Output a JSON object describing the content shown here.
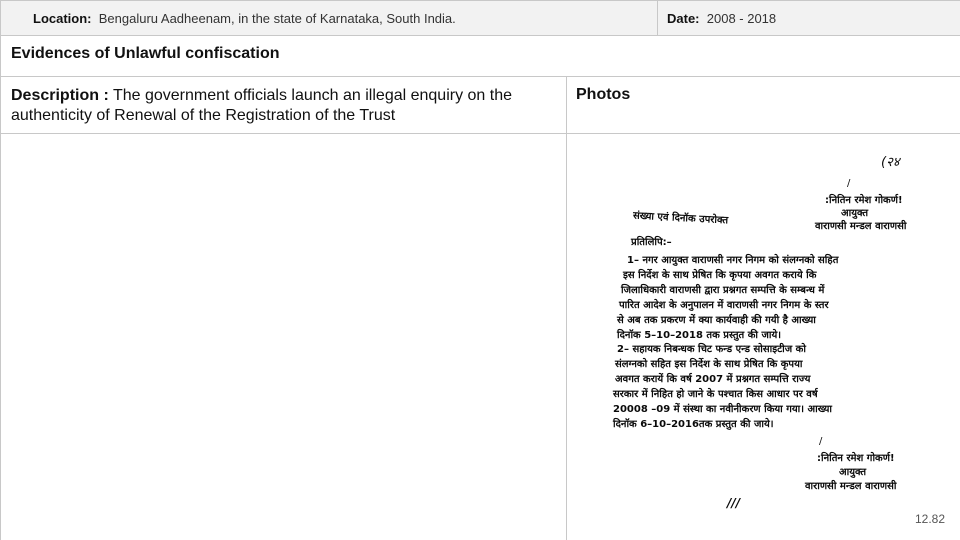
{
  "header": {
    "location_label": "Location:",
    "location_value": "Bengaluru Aadheenam, in the state of Karnataka, South India.",
    "date_label": "Date:",
    "date_value": "2008 - 2018"
  },
  "section": {
    "title": "Evidences of Unlawful confiscation"
  },
  "description": {
    "label": "Description :",
    "text": " The government officials launch an illegal enquiry on the authenticity of Renewal of the Registration of the Trust",
    "photos_label": "Photos"
  },
  "document_scan": {
    "page_mark": "(२४",
    "sig_top_1": "/",
    "sig_top_2": ":नितिन रमेश गोकर्ण!",
    "sig_top_3": "आयुक्त",
    "sig_top_4": "वाराणसी मन्डल वाराणसी",
    "ref_line": "संख्या एवं दिनॉक उपरोक्त",
    "copy_label": "प्रतिलिपि:–",
    "p1_l1": "1– नगर आयुक्त वाराणसी नगर निगम को संलग्नको सहित",
    "p1_l2": "इस निर्देश के साथ प्रेषित कि कृपया अवगत कराये कि",
    "p1_l3": "जिलाधिकारी वाराणसी द्वारा प्रश्नगत सम्पत्ति के सम्बन्ध में",
    "p1_l4": "पारित आदेश के अनुपालन में वाराणसी नगर निगम के स्तर",
    "p1_l5": "से अब तक प्रकरण में क्या कार्यवाही की गयी है आख्या",
    "p1_l6": "दिनॉक 5–10–2018 तक प्रस्तुत की जाये।",
    "p2_l1": "2– सहायक निबन्धक चिट फन्ड एन्ड सोसाइटीज को",
    "p2_l2": "संलग्नको सहित इस निर्देश के साथ प्रेषित कि कृपया",
    "p2_l3": "अवगत करायें कि वर्ष 2007 में प्रश्नगत सम्पत्ति राज्य",
    "p2_l4": "सरकार में निहित हो जाने के पश्चात किस आधार पर वर्ष",
    "p2_l5": "20008 –09 में संस्था का नवीनीकरण किया गया। आख्या",
    "p2_l6": "दिनॉक 6–10–2016तक प्रस्तुत की जाये।",
    "sig_bot_1": "/",
    "sig_bot_2": ":नितिन रमेश गोकर्ण!",
    "sig_bot_3": "आयुक्त",
    "sig_bot_4": "वाराणसी मन्डल वाराणसी",
    "end_mark": "///"
  },
  "slide_number": "12.82"
}
